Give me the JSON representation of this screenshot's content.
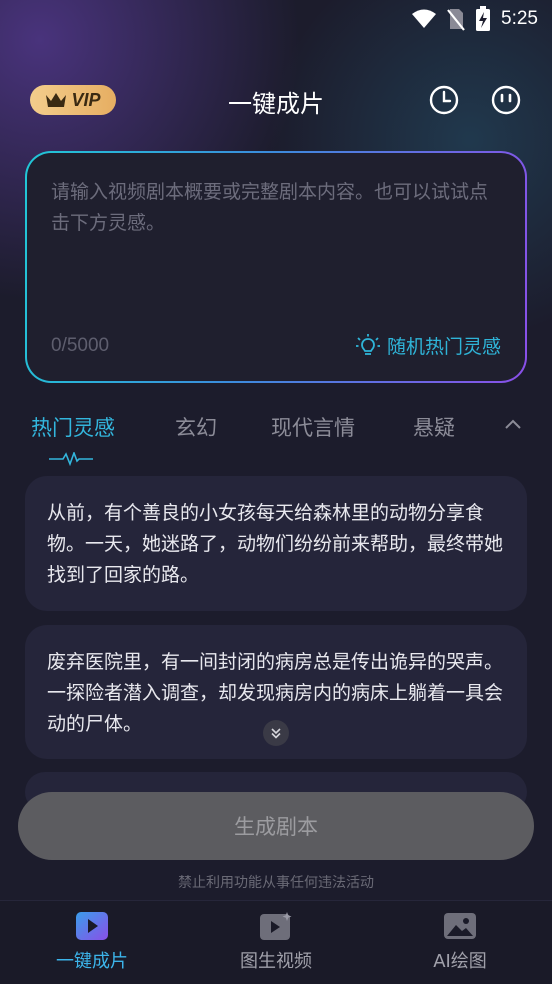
{
  "status_bar": {
    "time": "5:25"
  },
  "header": {
    "vip_label": "VIP",
    "title": "一键成片"
  },
  "input": {
    "placeholder": "请输入视频剧本概要或完整剧本内容。也可以试试点击下方灵感。",
    "counter": "0/5000",
    "random_label": "随机热门灵感"
  },
  "tabs": [
    {
      "label": "热门灵感",
      "active": true
    },
    {
      "label": "玄幻"
    },
    {
      "label": "现代言情"
    },
    {
      "label": "悬疑"
    }
  ],
  "cards": [
    {
      "text": "从前，有个善良的小女孩每天给森林里的动物分享食物。一天，她迷路了，动物们纷纷前来帮助，最终带她找到了回家的路。"
    },
    {
      "text": "废弃医院里，有一间封闭的病房总是传出诡异的哭声。一探险者潜入调查，却发现病房内的病床上躺着一具会动的尸体。"
    }
  ],
  "generate_button": "生成剧本",
  "disclaimer": "禁止利用功能从事任何违法活动",
  "bottom_nav": [
    {
      "label": "一键成片",
      "active": true
    },
    {
      "label": "图生视频"
    },
    {
      "label": "AI绘图"
    }
  ],
  "colors": {
    "accent": "#33b6dd",
    "vip_gold": "#e6ae62",
    "gradient_start": "#21c7d6",
    "gradient_end": "#8a4fe8"
  }
}
